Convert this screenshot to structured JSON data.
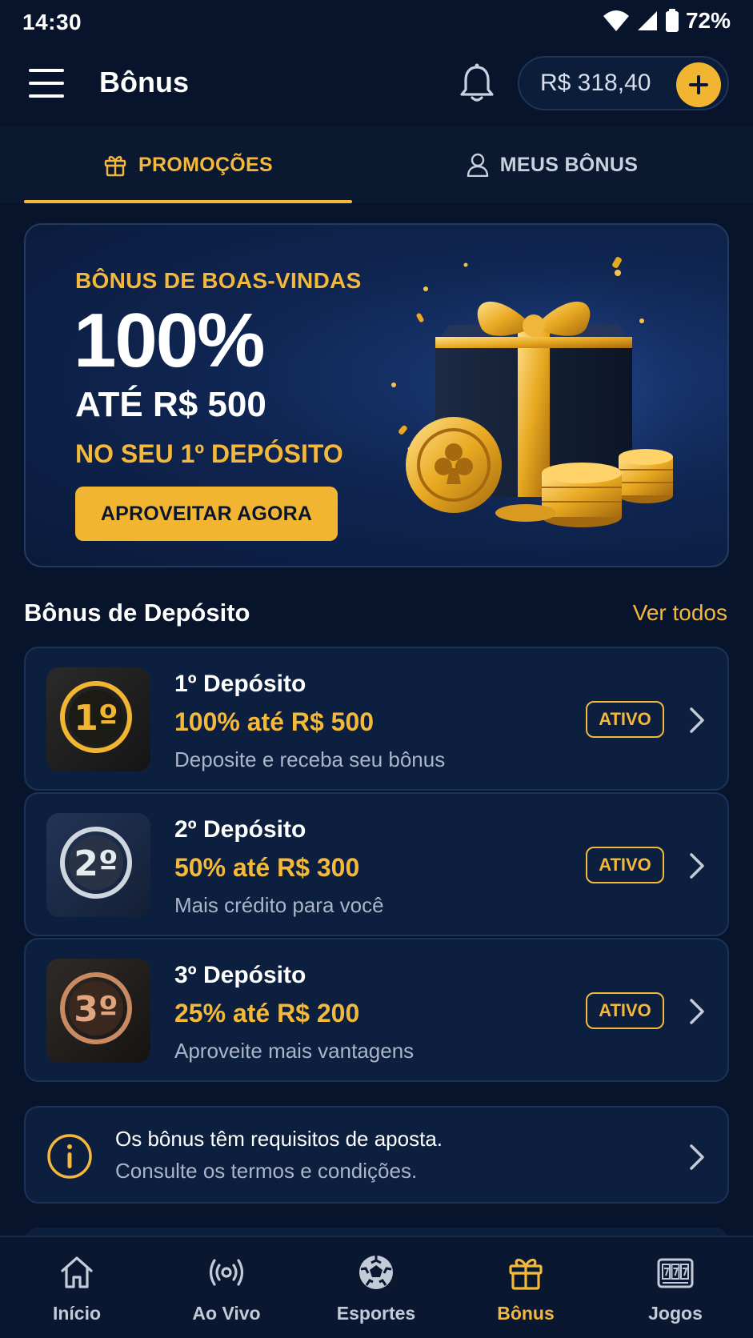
{
  "status_bar": {
    "time": "14:30",
    "battery": "72%"
  },
  "header": {
    "title": "Bônus",
    "balance": "R$ 318,40"
  },
  "tabs": [
    {
      "label": "PROMOÇÕES",
      "active": true
    },
    {
      "label": "MEUS BÔNUS",
      "active": false
    }
  ],
  "promo": {
    "eyebrow": "BÔNUS DE BOAS-VINDAS",
    "percent": "100%",
    "amount": "ATÉ R$ 500",
    "subtitle": "NO SEU 1º DEPÓSITO",
    "cta": "APROVEITAR AGORA"
  },
  "deposit_section": {
    "title": "Bônus de Depósito",
    "link": "Ver todos",
    "items": [
      {
        "medal": "1º",
        "title": "1º Depósito",
        "offer": "100% até R$ 500",
        "description": "Deposite e receba seu bônus",
        "badge": "ATIVO",
        "tier": "gold"
      },
      {
        "medal": "2º",
        "title": "2º Depósito",
        "offer": "50% até R$ 300",
        "description": "Mais crédito para você",
        "badge": "ATIVO",
        "tier": "silver"
      },
      {
        "medal": "3º",
        "title": "3º Depósito",
        "offer": "25% até R$ 200",
        "description": "Aproveite mais vantagens",
        "badge": "ATIVO",
        "tier": "bronze"
      }
    ]
  },
  "info": {
    "line1": "Os bônus têm requisitos de aposta.",
    "line2": "Consulte os termos e condições."
  },
  "bottom_nav": [
    {
      "label": "Início",
      "icon": "home-icon",
      "active": false
    },
    {
      "label": "Ao Vivo",
      "icon": "live-broadcast-icon",
      "active": false
    },
    {
      "label": "Esportes",
      "icon": "soccer-ball-icon",
      "active": false
    },
    {
      "label": "Bônus",
      "icon": "gift-icon",
      "active": true
    },
    {
      "label": "Jogos",
      "icon": "slot-machine-icon",
      "active": false
    }
  ],
  "colors": {
    "accent": "#f4b93a",
    "background": "#07142b",
    "card": "#0d1f3f"
  }
}
